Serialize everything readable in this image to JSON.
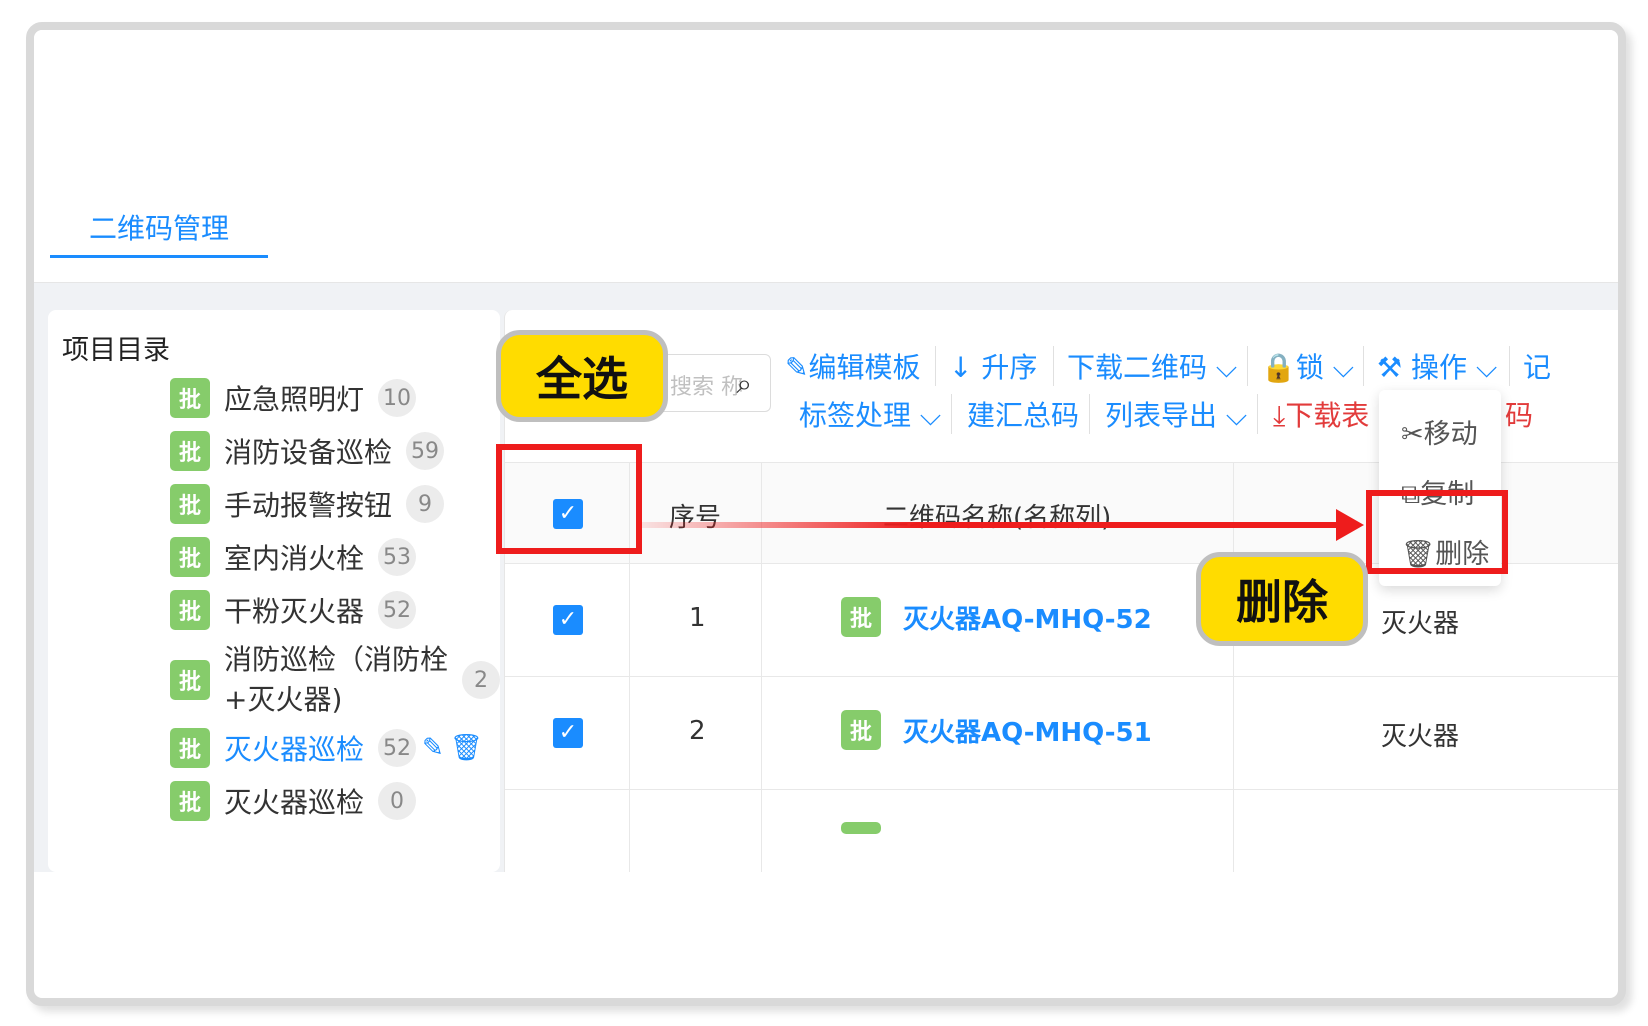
{
  "tab": {
    "label": "二维码管理"
  },
  "sidebar": {
    "title": "项目目录",
    "badge": "批",
    "items": [
      {
        "label": "应急照明灯",
        "count": "10"
      },
      {
        "label": "消防设备巡检",
        "count": "59"
      },
      {
        "label": "手动报警按钮",
        "count": "9"
      },
      {
        "label": "室内消火栓",
        "count": "53"
      },
      {
        "label": "干粉灭火器",
        "count": "52"
      },
      {
        "label": "消防巡检（消防栓+灭火器)",
        "count": "2"
      },
      {
        "label": "灭火器巡检",
        "count": "52"
      },
      {
        "label": "灭火器巡检",
        "count": "0"
      }
    ]
  },
  "search": {
    "placeholder": "搜索 称"
  },
  "toolbar": {
    "row1": [
      "编辑模板",
      "升序",
      "下载二维码",
      "锁",
      "操作",
      "记"
    ],
    "row2": [
      "标签处理",
      "建汇总码",
      "列表导出",
      "下载表"
    ],
    "row2_tail": "码"
  },
  "menu": {
    "items": [
      "移动",
      "复制",
      "删除"
    ]
  },
  "table": {
    "headers": {
      "seq": "序号",
      "name": "二维码名称(名称列)"
    },
    "badge": "批",
    "rows": [
      {
        "seq": "1",
        "name": "灭火器AQ-MHQ-52",
        "type": "灭火器"
      },
      {
        "seq": "2",
        "name": "灭火器AQ-MHQ-51",
        "type": "灭火器"
      }
    ]
  },
  "annotations": {
    "select_all": "全选",
    "delete": "删除"
  },
  "colors": {
    "accent": "#1a8cff",
    "badge_green": "#86cc6b",
    "highlight_red": "#ee1c1c",
    "callout_yellow": "#ffdc00"
  }
}
